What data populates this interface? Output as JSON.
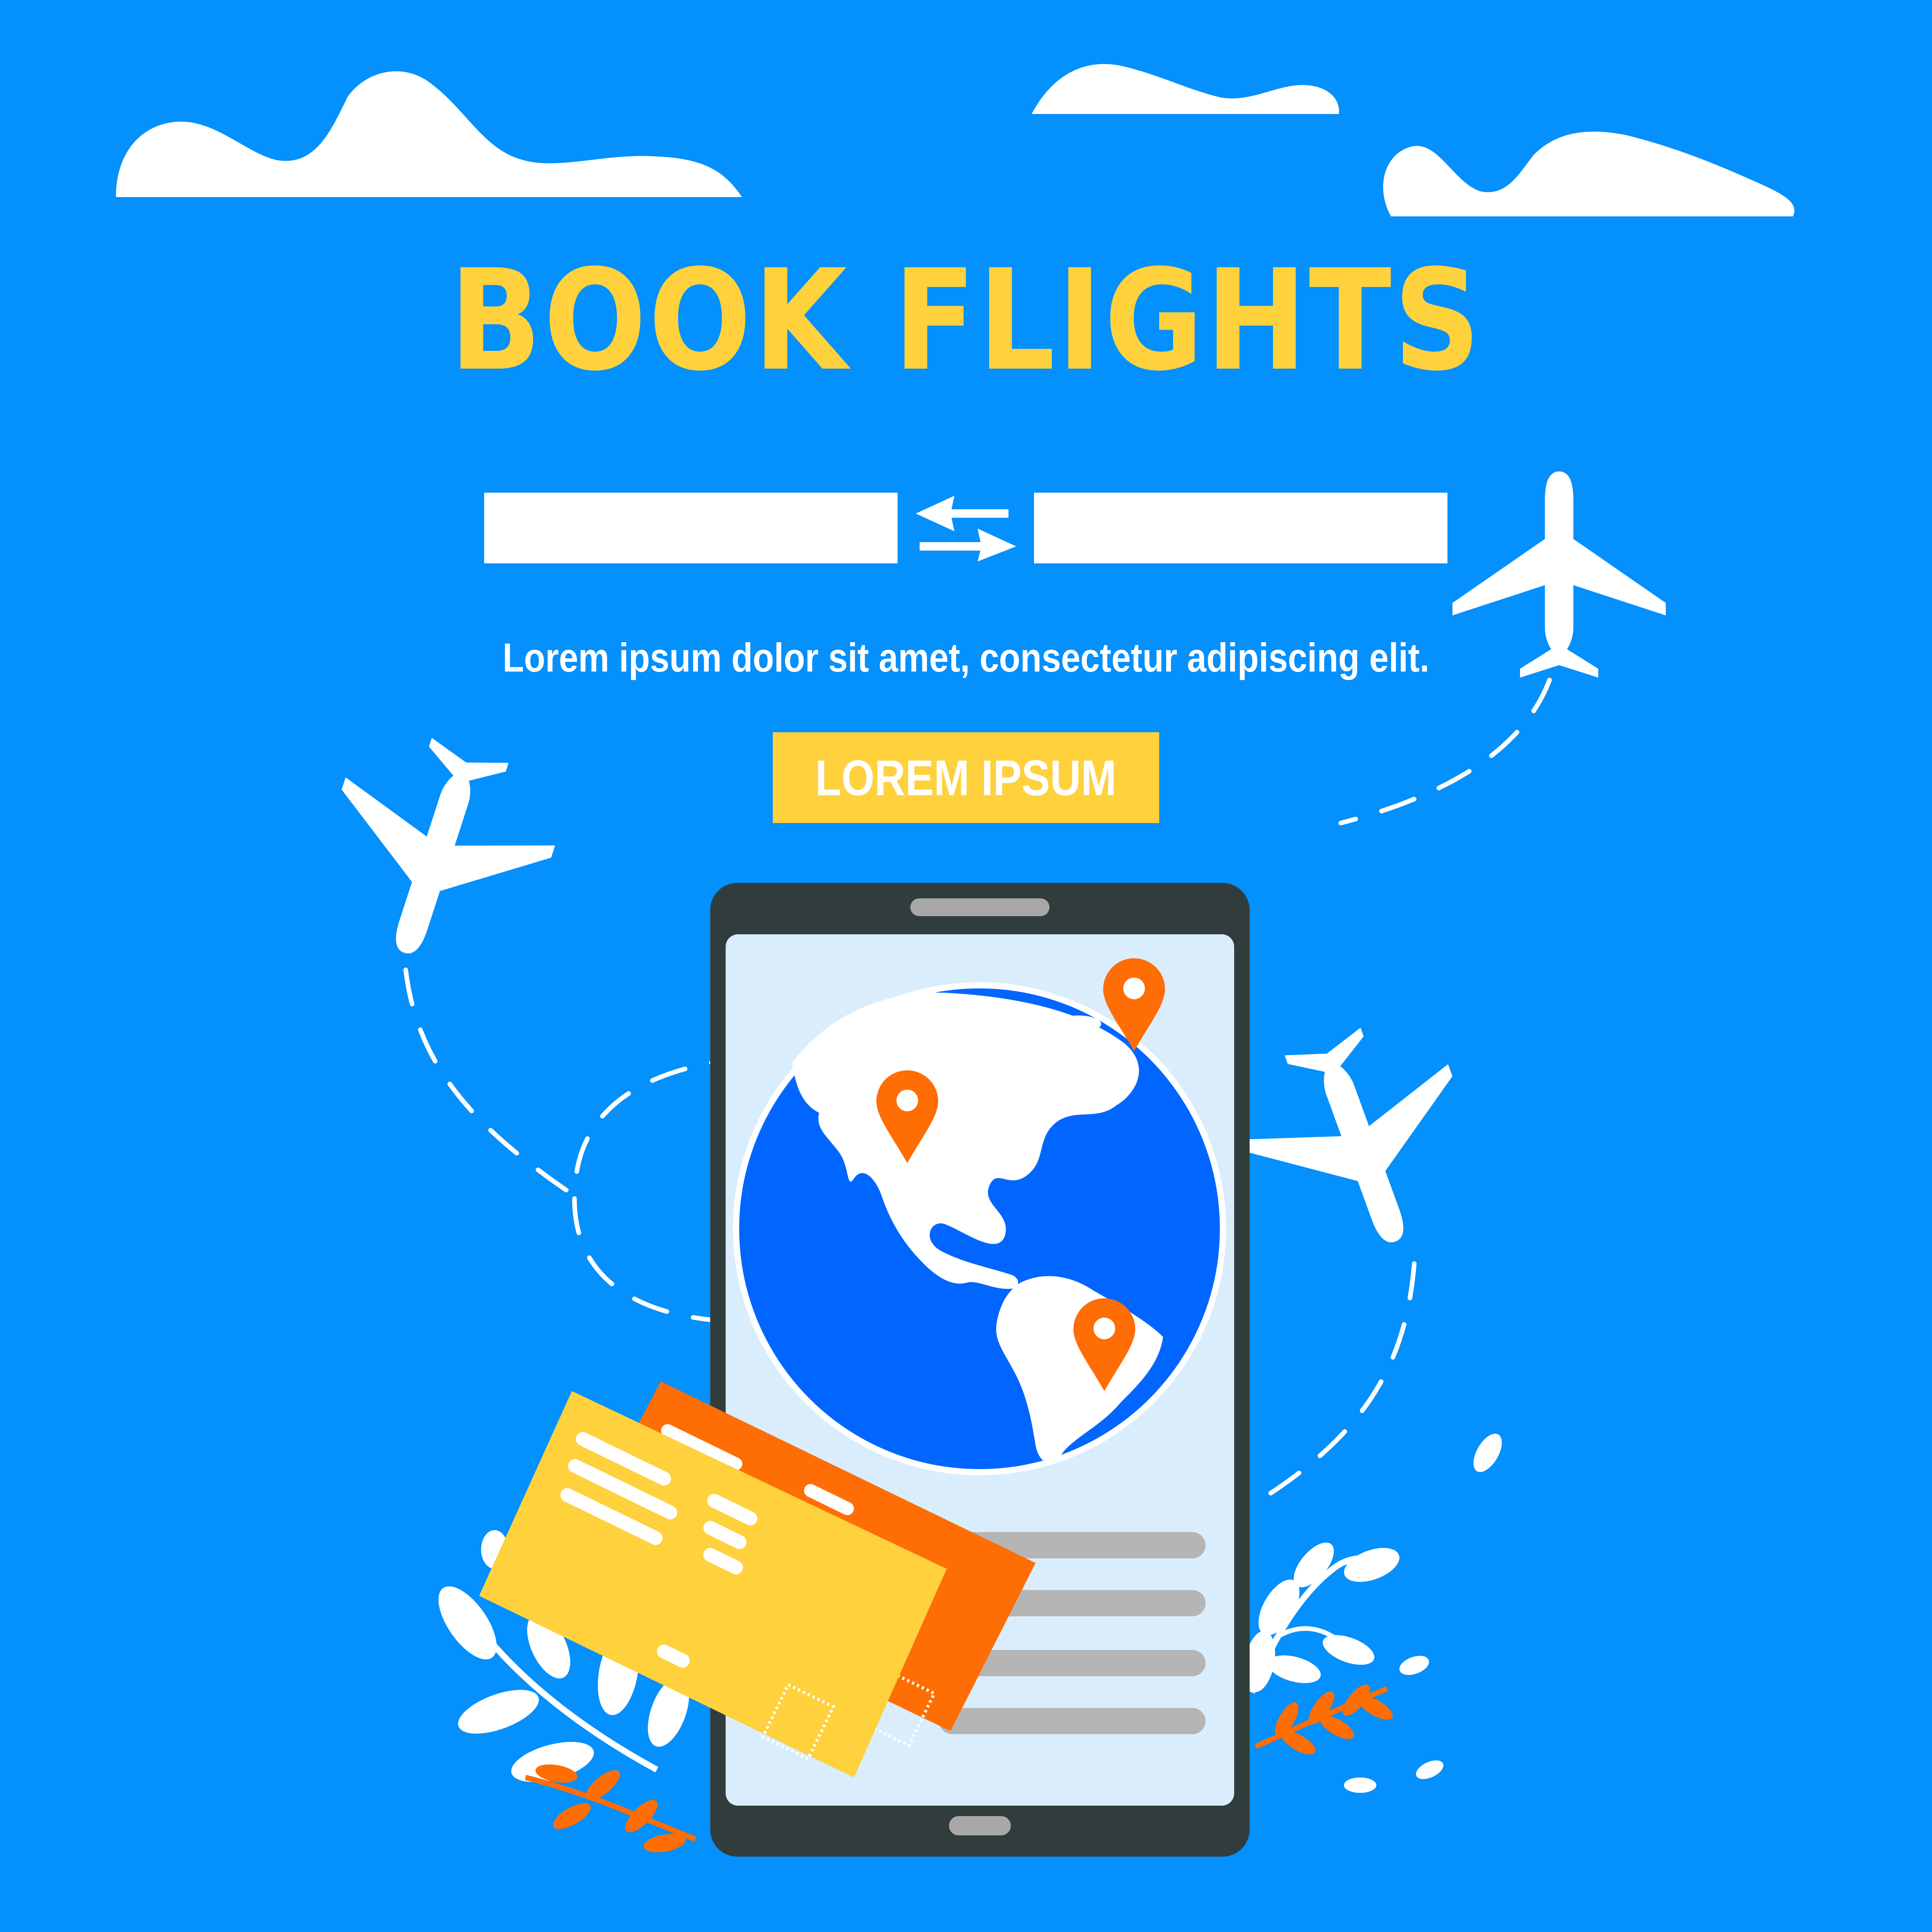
{
  "page": {
    "title": "BOOK FLIGHTS",
    "subtitle": "Lorem ipsum dolor sit amet, consectetur adipiscing elit.",
    "cta_label": "LOREM IPSUM"
  },
  "search": {
    "from_value": "",
    "to_value": ""
  },
  "icons": {
    "swap": "swap-arrows-icon",
    "airplane": "airplane-icon",
    "location_pin": "location-pin-icon",
    "globe": "globe-icon",
    "ticket": "ticket-icon",
    "cloud": "cloud-icon",
    "leaf": "leaf-icon"
  },
  "colors": {
    "background": "#0490fd",
    "accent_yellow": "#fed13d",
    "accent_orange": "#ff6d05",
    "phone_frame": "#313d3c",
    "phone_screen": "#daedfc",
    "globe_ocean": "#0066ff",
    "text_white": "#ffffff",
    "list_gray": "#b5b5b5"
  }
}
